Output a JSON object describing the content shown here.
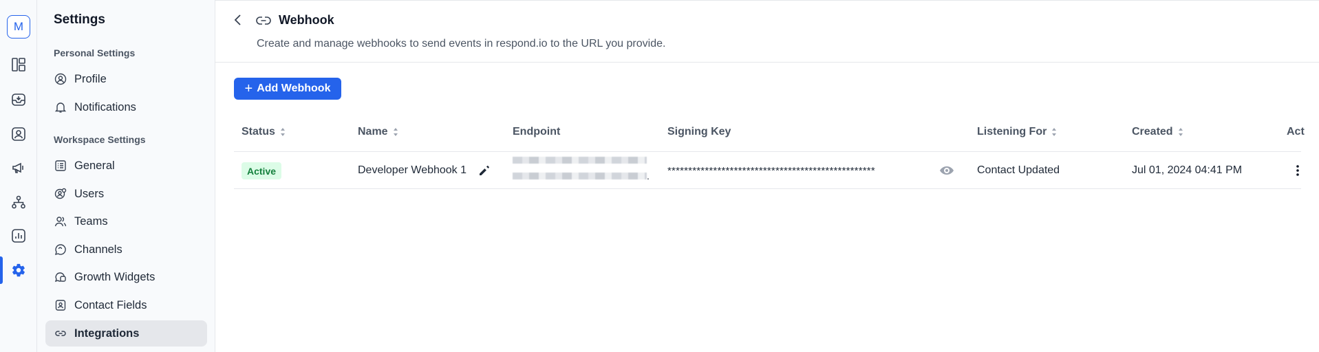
{
  "rail": {
    "avatar_letter": "M"
  },
  "sidebar": {
    "title": "Settings",
    "personal_heading": "Personal Settings",
    "personal_items": [
      {
        "label": "Profile",
        "icon": "user-circle-icon"
      },
      {
        "label": "Notifications",
        "icon": "bell-icon"
      }
    ],
    "workspace_heading": "Workspace Settings",
    "workspace_items": [
      {
        "label": "General",
        "icon": "list-icon"
      },
      {
        "label": "Users",
        "icon": "users-icon"
      },
      {
        "label": "Teams",
        "icon": "team-icon"
      },
      {
        "label": "Channels",
        "icon": "chat-icon"
      },
      {
        "label": "Growth Widgets",
        "icon": "widget-icon"
      },
      {
        "label": "Contact Fields",
        "icon": "contact-card-icon"
      },
      {
        "label": "Integrations",
        "icon": "link-icon",
        "active": true
      }
    ]
  },
  "header": {
    "title": "Webhook",
    "description": "Create and manage webhooks to send events in respond.io to the URL you provide."
  },
  "add_button_label": "Add Webhook",
  "table": {
    "columns": [
      "Status",
      "Name",
      "Endpoint",
      "Signing Key",
      "Listening For",
      "Created",
      "Act"
    ],
    "rows": [
      {
        "status": "Active",
        "name": "Developer Webhook 1",
        "endpoint_suffix": ".",
        "signing_key": "**************************************************",
        "listening_for": "Contact Updated",
        "created": "Jul 01, 2024 04:41 PM"
      }
    ]
  },
  "colors": {
    "accent": "#2563eb",
    "active_badge_bg": "#dcfce7",
    "active_badge_text": "#15803d"
  }
}
